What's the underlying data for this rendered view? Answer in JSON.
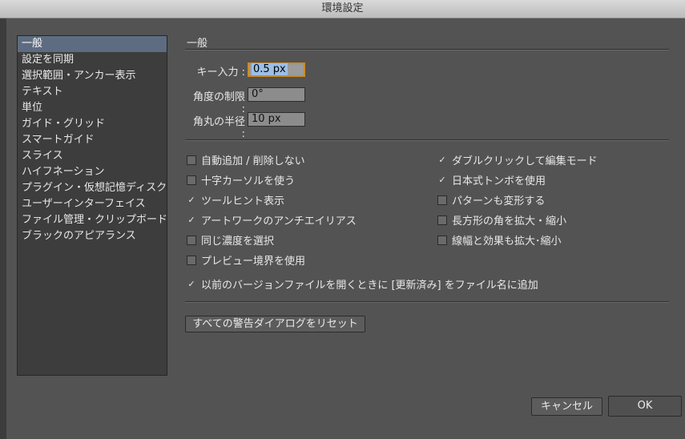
{
  "window": {
    "title": "環境設定"
  },
  "sidebar": {
    "items": [
      {
        "label": "一般",
        "selected": true
      },
      {
        "label": "設定を同期",
        "selected": false
      },
      {
        "label": "選択範囲・アンカー表示",
        "selected": false
      },
      {
        "label": "テキスト",
        "selected": false
      },
      {
        "label": "単位",
        "selected": false
      },
      {
        "label": "ガイド・グリッド",
        "selected": false
      },
      {
        "label": "スマートガイド",
        "selected": false
      },
      {
        "label": "スライス",
        "selected": false
      },
      {
        "label": "ハイフネーション",
        "selected": false
      },
      {
        "label": "プラグイン・仮想記憶ディスク",
        "selected": false
      },
      {
        "label": "ユーザーインターフェイス",
        "selected": false
      },
      {
        "label": "ファイル管理・クリップボード",
        "selected": false
      },
      {
        "label": "ブラックのアピアランス",
        "selected": false
      }
    ]
  },
  "general": {
    "title": "一般",
    "key_increment": {
      "label": "キー入力 :",
      "value": "0.5 px"
    },
    "constrain_angle": {
      "label": "角度の制限 :",
      "value": "0°"
    },
    "corner_radius": {
      "label": "角丸の半径 :",
      "value": "10 px"
    },
    "options_left": [
      {
        "label": "自動追加 / 削除しない",
        "checked": false
      },
      {
        "label": "十字カーソルを使う",
        "checked": false
      },
      {
        "label": "ツールヒント表示",
        "checked": true
      },
      {
        "label": "アートワークのアンチエイリアス",
        "checked": true
      },
      {
        "label": "同じ濃度を選択",
        "checked": false
      },
      {
        "label": "プレビュー境界を使用",
        "checked": false
      }
    ],
    "options_right": [
      {
        "label": "ダブルクリックして編集モード",
        "checked": true
      },
      {
        "label": "日本式トンボを使用",
        "checked": true
      },
      {
        "label": "パターンも変形する",
        "checked": false
      },
      {
        "label": "長方形の角を拡大・縮小",
        "checked": false
      },
      {
        "label": "線幅と効果も拡大･縮小",
        "checked": false
      }
    ],
    "append_updated": {
      "label": "以前のバージョンファイルを開くときに [更新済み] をファイル名に追加",
      "checked": true
    },
    "reset_warnings_label": "すべての警告ダイアログをリセット"
  },
  "footer": {
    "cancel_label": "キャンセル",
    "ok_label": "OK"
  },
  "check_glyph": "✓",
  "colors": {
    "selection": "#5d6c80",
    "focus_border": "#c88a2c"
  }
}
